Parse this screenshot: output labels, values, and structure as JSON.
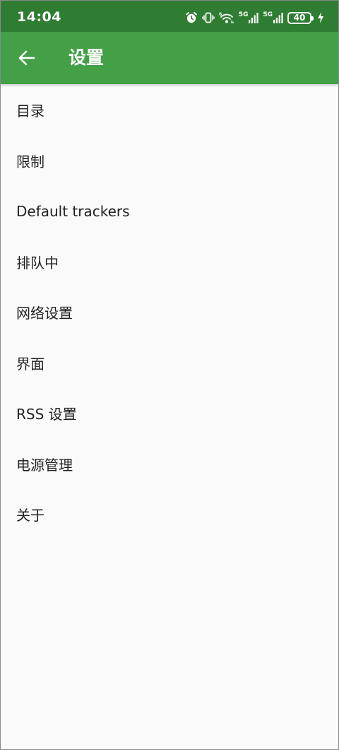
{
  "status_bar": {
    "time": "14:04",
    "battery": "40",
    "network_1": "5G",
    "network_2": "5G",
    "icons": [
      "alarm-icon",
      "vibrate-icon",
      "wifi-icon",
      "signal-icon",
      "signal-icon",
      "battery-icon",
      "charging-icon"
    ]
  },
  "app_bar": {
    "title": "设置",
    "back_icon": "arrow-left-icon"
  },
  "colors": {
    "status_bar": "#2e7d32",
    "app_bar": "#43a047",
    "background": "#fafafa",
    "text": "#212121"
  },
  "settings": {
    "items": [
      {
        "label": "目录"
      },
      {
        "label": "限制"
      },
      {
        "label": "Default trackers"
      },
      {
        "label": "排队中"
      },
      {
        "label": "网络设置"
      },
      {
        "label": "界面"
      },
      {
        "label": "RSS 设置"
      },
      {
        "label": "电源管理"
      },
      {
        "label": "关于"
      }
    ]
  }
}
